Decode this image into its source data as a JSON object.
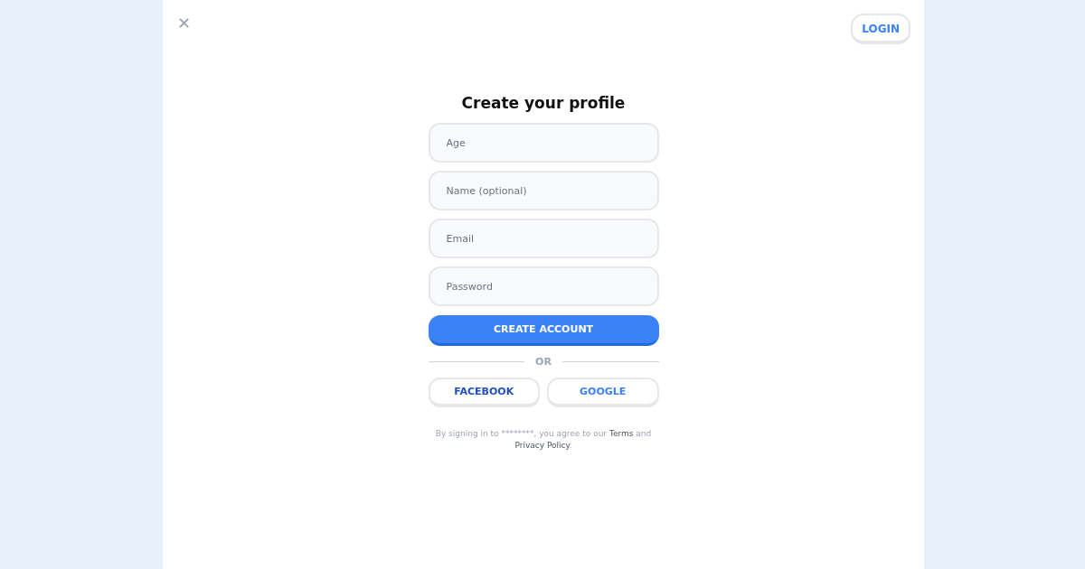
{
  "close_button": {
    "label": "✕"
  },
  "login_button": {
    "label": "LOGIN"
  },
  "title": "Create your profile",
  "fields": [
    {
      "placeholder": "Age"
    },
    {
      "placeholder": "Name (optional)"
    },
    {
      "placeholder": "Email"
    },
    {
      "placeholder": "Password"
    }
  ],
  "submit_button": {
    "label": "CREATE ACCOUNT"
  },
  "divider_label": "OR",
  "social_buttons": [
    {
      "label": "FACEBOOK",
      "color": "#1e4fc4"
    },
    {
      "label": "GOOGLE",
      "color": "#3b82f6"
    }
  ],
  "legal": {
    "before": "By signing in to ********, you agree to our",
    "terms_link": "Terms",
    "middle": "and",
    "privacy_link": "Privacy Policy",
    "after": "."
  }
}
